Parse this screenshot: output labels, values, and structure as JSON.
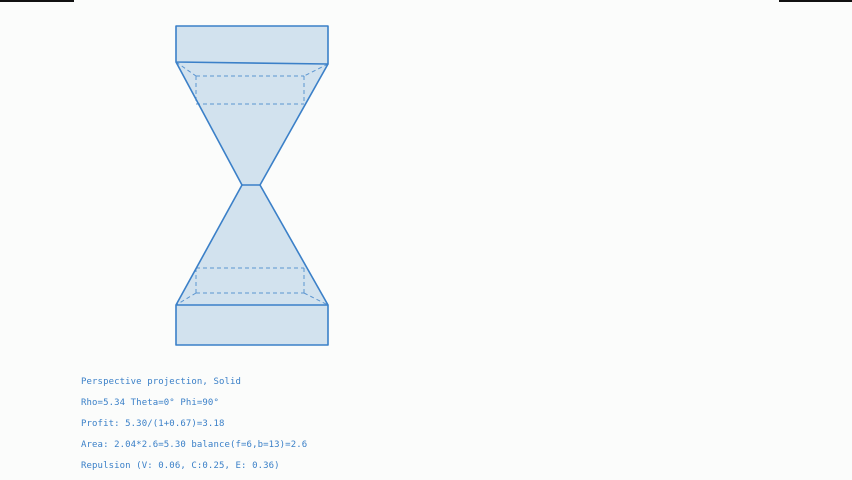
{
  "window": {
    "background": "#fbfcfb"
  },
  "model": {
    "shape": "hourglass-frustum-pair",
    "projection": "Perspective",
    "render_mode": "Solid",
    "stroke_color": "#3b80c8",
    "fill_color": "#d2e2ee"
  },
  "readout": {
    "line1": "Perspective projection, Solid",
    "line2": "Rho=5.34 Theta=0° Phi=90°",
    "line3": "Profit: 5.30/(1+0.67)=3.18",
    "line4": "Area: 2.04*2.6=5.30 balance(f=6,b=13)=2.6",
    "line5": "Repulsion (V: 0.06, C:0.25, E: 0.36)"
  }
}
